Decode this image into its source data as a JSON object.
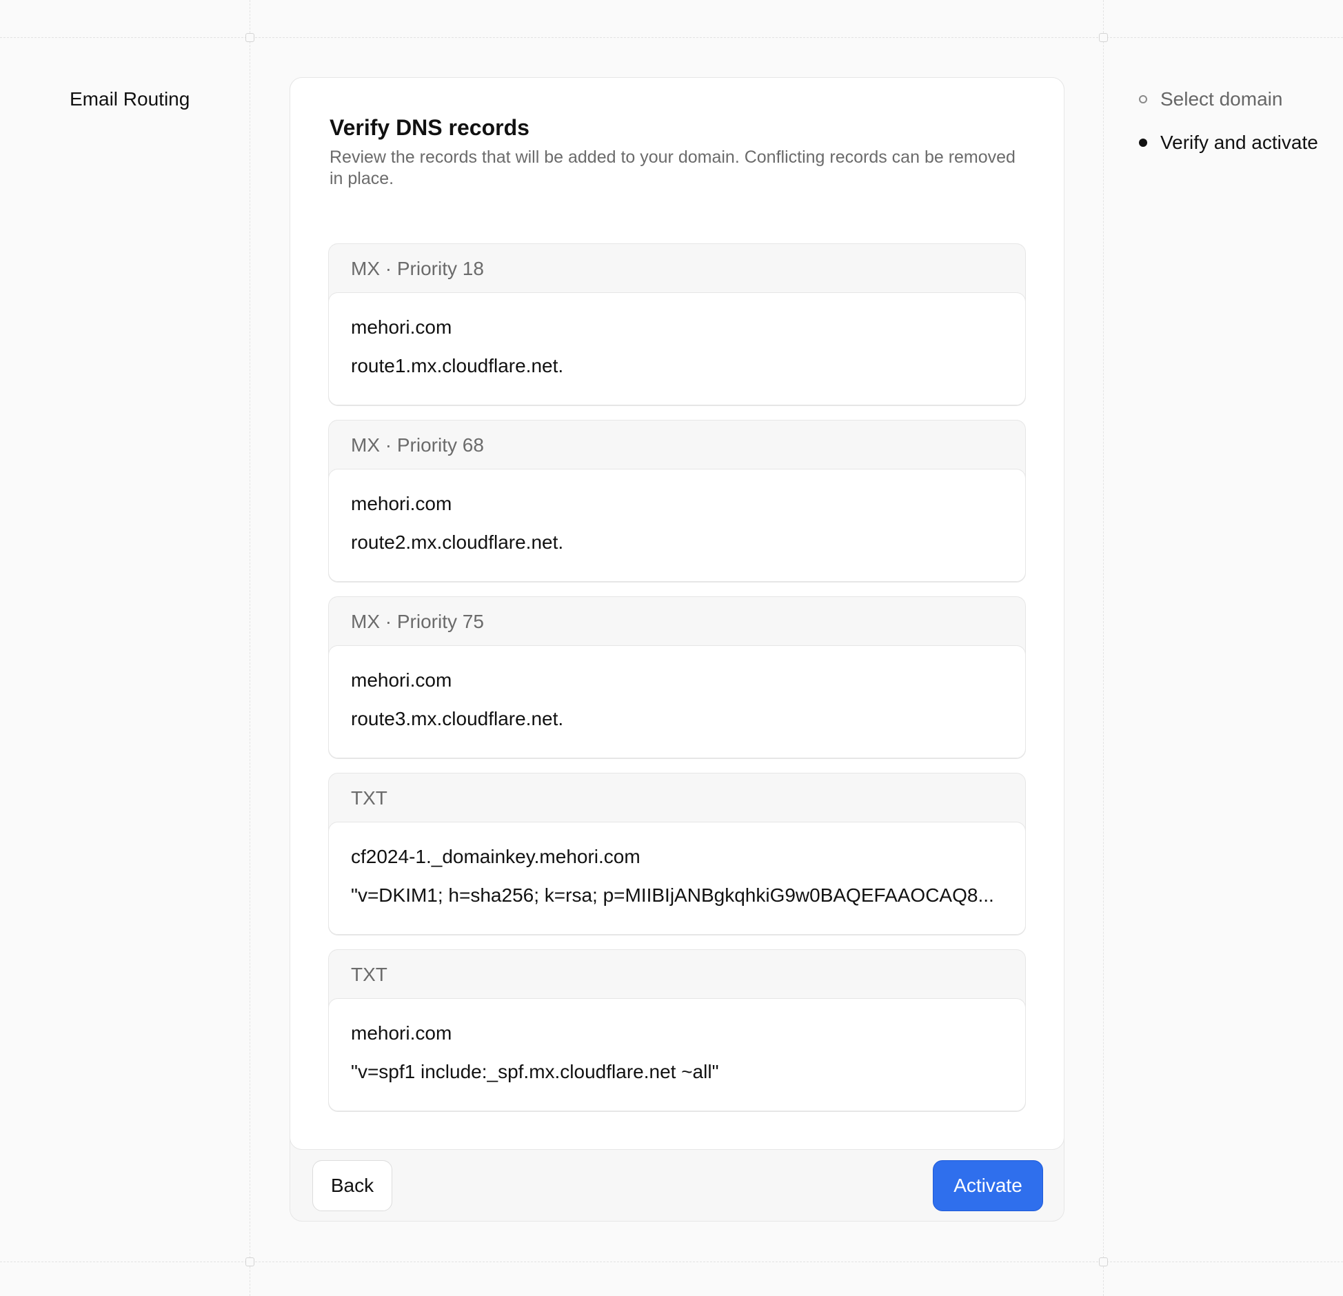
{
  "app": {
    "title": "Email Routing"
  },
  "steps": [
    {
      "label": "Select domain",
      "state": "inactive"
    },
    {
      "label": "Verify and activate",
      "state": "active"
    }
  ],
  "card": {
    "title": "Verify DNS records",
    "description": "Review the records that will be added to your domain. Conflicting records can be removed in place."
  },
  "records": [
    {
      "type": "MX",
      "meta": "· Priority 18",
      "name": "mehori.com",
      "value": "route1.mx.cloudflare.net."
    },
    {
      "type": "MX",
      "meta": "· Priority 68",
      "name": "mehori.com",
      "value": "route2.mx.cloudflare.net."
    },
    {
      "type": "MX",
      "meta": "· Priority 75",
      "name": "mehori.com",
      "value": "route3.mx.cloudflare.net."
    },
    {
      "type": "TXT",
      "meta": "",
      "name": "cf2024-1._domainkey.mehori.com",
      "value": "\"v=DKIM1; h=sha256; k=rsa; p=MIIBIjANBgkqhkiG9w0BAQEFAAOCAQ8..."
    },
    {
      "type": "TXT",
      "meta": "",
      "name": "mehori.com",
      "value": "\"v=spf1 include:_spf.mx.cloudflare.net ~all\""
    }
  ],
  "actions": {
    "back_label": "Back",
    "activate_label": "Activate"
  },
  "colors": {
    "accent": "#2f6fed",
    "background": "#fafafa",
    "card": "#ffffff",
    "muted_text": "#6b6b6b"
  }
}
